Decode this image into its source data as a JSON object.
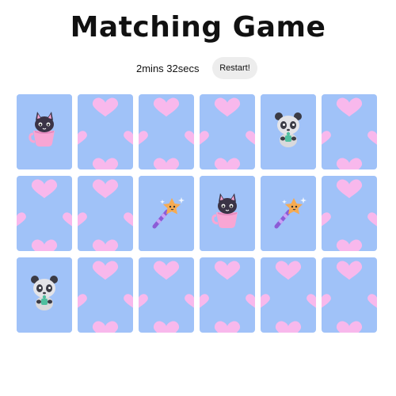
{
  "title": "Matching Game",
  "timer": "2mins 32secs",
  "restart_label": "Restart!",
  "colors": {
    "card_back": "#a0c2f8",
    "heart": "#f8b8ec",
    "restart_bg": "#ededed"
  },
  "cards": [
    {
      "state": "revealed",
      "icon": "cat-in-cup-icon"
    },
    {
      "state": "hidden",
      "icon": "heart-pattern-icon"
    },
    {
      "state": "hidden",
      "icon": "heart-pattern-icon"
    },
    {
      "state": "hidden",
      "icon": "heart-pattern-icon"
    },
    {
      "state": "revealed",
      "icon": "panda-icon"
    },
    {
      "state": "hidden",
      "icon": "heart-pattern-icon"
    },
    {
      "state": "hidden",
      "icon": "heart-pattern-icon"
    },
    {
      "state": "hidden",
      "icon": "heart-pattern-icon"
    },
    {
      "state": "revealed",
      "icon": "magic-wand-icon"
    },
    {
      "state": "revealed",
      "icon": "cat-in-cup-icon"
    },
    {
      "state": "revealed",
      "icon": "magic-wand-icon"
    },
    {
      "state": "hidden",
      "icon": "heart-pattern-icon"
    },
    {
      "state": "revealed",
      "icon": "panda-icon"
    },
    {
      "state": "hidden",
      "icon": "heart-pattern-icon"
    },
    {
      "state": "hidden",
      "icon": "heart-pattern-icon"
    },
    {
      "state": "hidden",
      "icon": "heart-pattern-icon"
    },
    {
      "state": "hidden",
      "icon": "heart-pattern-icon"
    },
    {
      "state": "hidden",
      "icon": "heart-pattern-icon"
    }
  ]
}
